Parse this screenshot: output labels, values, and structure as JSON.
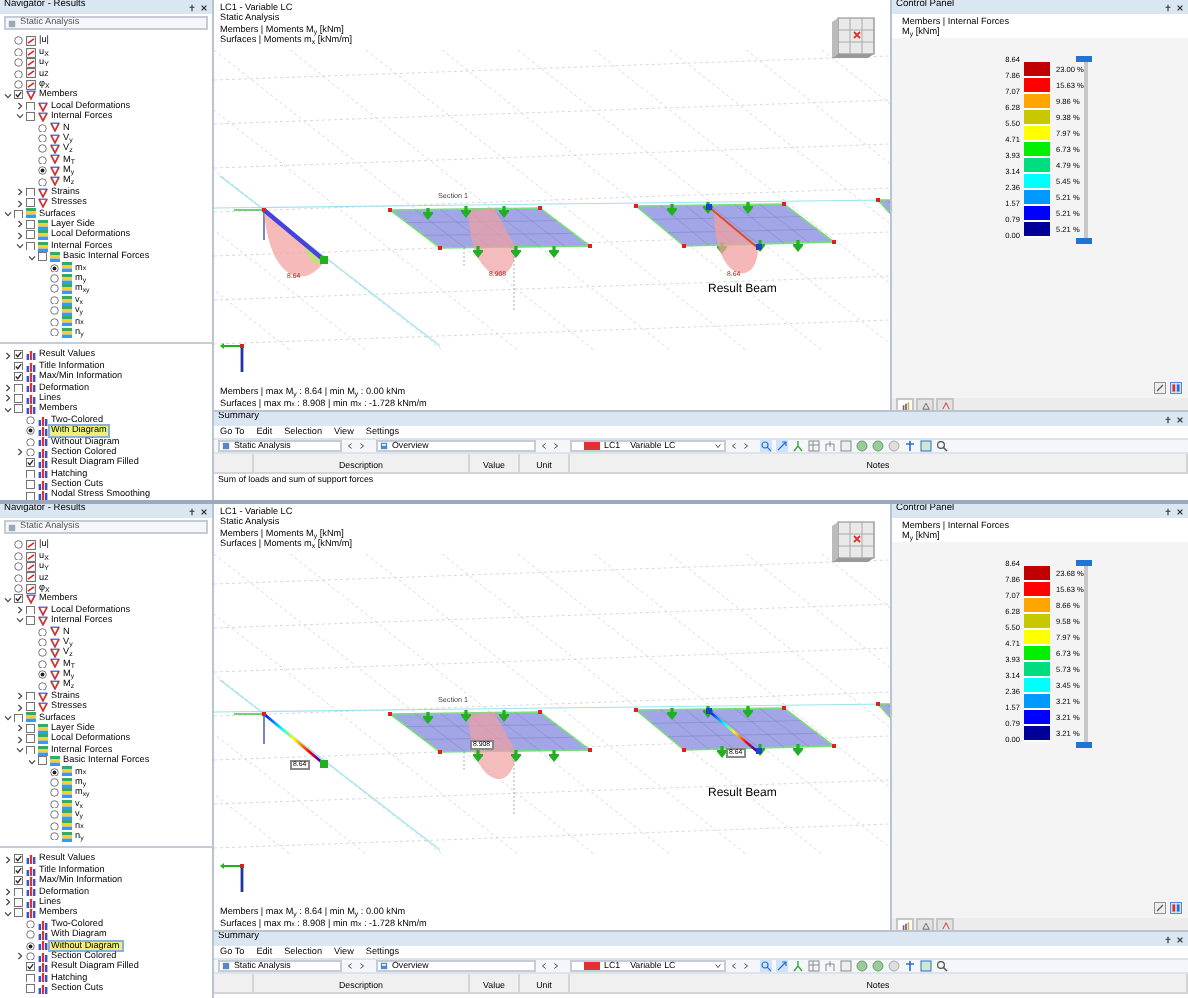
{
  "screens": [
    {
      "navigator": {
        "title": "Navigator - Results",
        "analysis": "Static Analysis",
        "results_tree": [
          {
            "label": "|u|",
            "kind": "radio",
            "checked": false
          },
          {
            "label": "u$_{X}$",
            "kind": "radio",
            "checked": false
          },
          {
            "label": "u$_{Y}$",
            "kind": "radio",
            "checked": false
          },
          {
            "label": "u$_{Z}$",
            "kind": "radio",
            "checked": false
          },
          {
            "label": "φ$_{X}$",
            "kind": "radio",
            "checked": false
          },
          {
            "label": "Members",
            "kind": "check",
            "checked": true,
            "expanded": true,
            "children": [
              {
                "label": "Local Deformations",
                "kind": "check",
                "checked": false,
                "expanded": false
              },
              {
                "label": "Internal Forces",
                "kind": "check",
                "checked": false,
                "expanded": true,
                "children": [
                  {
                    "label": "N",
                    "kind": "radio",
                    "checked": false
                  },
                  {
                    "label": "V$_{y}$",
                    "kind": "radio",
                    "checked": false
                  },
                  {
                    "label": "V$_{z}$",
                    "kind": "radio",
                    "checked": false
                  },
                  {
                    "label": "M$_{T}$",
                    "kind": "radio",
                    "checked": false
                  },
                  {
                    "label": "M$_{y}$",
                    "kind": "radio",
                    "checked": true
                  },
                  {
                    "label": "M$_{z}$",
                    "kind": "radio",
                    "checked": false
                  }
                ]
              },
              {
                "label": "Strains",
                "kind": "check",
                "checked": false,
                "expanded": false
              },
              {
                "label": "Stresses",
                "kind": "check",
                "checked": false,
                "expanded": false
              }
            ]
          },
          {
            "label": "Surfaces",
            "kind": "check",
            "checked": false,
            "expanded": true,
            "children": [
              {
                "label": "Layer Side",
                "kind": "check",
                "checked": false,
                "expanded": false
              },
              {
                "label": "Local Deformations",
                "kind": "check",
                "checked": false,
                "expanded": false
              },
              {
                "label": "Internal Forces",
                "kind": "check",
                "checked": false,
                "expanded": true,
                "children": [
                  {
                    "label": "Basic Internal Forces",
                    "kind": "check",
                    "checked": false,
                    "expanded": true,
                    "children": [
                      {
                        "label": "m$_{x}$",
                        "kind": "radio",
                        "checked": true
                      },
                      {
                        "label": "m$_{y}$",
                        "kind": "radio",
                        "checked": false
                      },
                      {
                        "label": "m$_{xy}$",
                        "kind": "radio",
                        "checked": false
                      },
                      {
                        "label": "v$_{x}$",
                        "kind": "radio",
                        "checked": false
                      },
                      {
                        "label": "v$_{y}$",
                        "kind": "radio",
                        "checked": false
                      },
                      {
                        "label": "n$_{x}$",
                        "kind": "radio",
                        "checked": false
                      },
                      {
                        "label": "n$_{y}$",
                        "kind": "radio",
                        "checked": false
                      }
                    ]
                  }
                ]
              }
            ]
          }
        ],
        "display_tree": [
          {
            "label": "Result Values",
            "kind": "check",
            "checked": true,
            "expanded": false,
            "selected": false
          },
          {
            "label": "Title Information",
            "kind": "check",
            "checked": true,
            "selected": false
          },
          {
            "label": "Max/Min Information",
            "kind": "check",
            "checked": true,
            "selected": false
          },
          {
            "label": "Deformation",
            "kind": "check",
            "checked": false,
            "expanded": false,
            "selected": false
          },
          {
            "label": "Lines",
            "kind": "check",
            "checked": false,
            "expanded": false,
            "selected": false
          },
          {
            "label": "Members",
            "kind": "check",
            "checked": false,
            "expanded": true,
            "selected": false,
            "children": [
              {
                "label": "Two-Colored",
                "kind": "radio",
                "checked": false,
                "selected": false
              },
              {
                "label": "With Diagram",
                "kind": "radio",
                "checked": true,
                "selected": true
              },
              {
                "label": "Without Diagram",
                "kind": "radio",
                "checked": false,
                "selected": false
              },
              {
                "label": "Section Colored",
                "kind": "radio",
                "checked": false,
                "expanded": false,
                "selected": false
              },
              {
                "label": "Result Diagram Filled",
                "kind": "check",
                "checked": true,
                "selected": false
              },
              {
                "label": "Hatching",
                "kind": "check",
                "checked": false,
                "selected": false
              },
              {
                "label": "Section Cuts",
                "kind": "check",
                "checked": false,
                "selected": false
              },
              {
                "label": "Nodal Stress Smoothing",
                "kind": "check",
                "checked": false,
                "selected": false
              }
            ]
          }
        ]
      },
      "viewport": {
        "info_lines": [
          "LC1 - Variable LC",
          "Static Analysis",
          "Members | Moments M$_{y}$ [kNm]",
          "Surfaces | Moments m$_{x}$ [kNm/m]"
        ],
        "section_label": "Section 1",
        "result_label": "Result Beam",
        "diagram_labels": [
          "8.64",
          "8.908",
          "8.64"
        ],
        "footer_lines": [
          "Members | max M$_{y}$ : 8.64 | min M$_{y}$ : 0.00 kNm",
          "Surfaces | max m$_{x}$ : 8.908 | min m$_{x}$ : -1.728 kNm/m"
        ]
      },
      "control_panel": {
        "title": "Control Panel",
        "subtitle_lines": [
          "Members | Internal Forces",
          "M$_{y}$ [kNm]"
        ],
        "legend": [
          {
            "value": "8.64",
            "color": "#c00000",
            "share": "23.00 %"
          },
          {
            "value": "7.86",
            "color": "#ff0000",
            "share": "15.63 %"
          },
          {
            "value": "7.07",
            "color": "#ffa500",
            "share": "9.86 %"
          },
          {
            "value": "6.28",
            "color": "#c8c800",
            "share": "9.38 %"
          },
          {
            "value": "5.50",
            "color": "#ffff00",
            "share": "7.97 %"
          },
          {
            "value": "4.71",
            "color": "#00ee00",
            "share": "6.73 %"
          },
          {
            "value": "3.93",
            "color": "#00dd80",
            "share": "4.79 %"
          },
          {
            "value": "3.14",
            "color": "#00ffff",
            "share": "5.45 %"
          },
          {
            "value": "2.36",
            "color": "#0099ff",
            "share": "5.21 %"
          },
          {
            "value": "1.57",
            "color": "#0000ff",
            "share": "5.21 %"
          },
          {
            "value": "0.79",
            "color": "#000099",
            "share": "5.21 %"
          }
        ],
        "min_value": "0.00",
        "tabs": [
          {
            "selected": true
          },
          {
            "selected": false
          },
          {
            "selected": false
          }
        ]
      },
      "summary": {
        "title": "Summary",
        "menu": [
          "Go To",
          "Edit",
          "Selection",
          "View",
          "Settings"
        ],
        "analysis": "Static Analysis",
        "view": "Overview",
        "load_case": "LC1",
        "load_case_name": "Variable LC",
        "columns": [
          "Description",
          "Value",
          "Unit",
          "Notes"
        ],
        "rows": [
          "Sum of loads and sum of support forces"
        ]
      }
    },
    {
      "navigator": {
        "title": "Navigator - Results",
        "analysis": "Static Analysis",
        "results_tree": [
          {
            "label": "|u|",
            "kind": "radio",
            "checked": false
          },
          {
            "label": "u$_{X}$",
            "kind": "radio",
            "checked": false
          },
          {
            "label": "u$_{Y}$",
            "kind": "radio",
            "checked": false
          },
          {
            "label": "u$_{Z}$",
            "kind": "radio",
            "checked": false
          },
          {
            "label": "φ$_{X}$",
            "kind": "radio",
            "checked": false
          },
          {
            "label": "Members",
            "kind": "check",
            "checked": true,
            "expanded": true,
            "children": [
              {
                "label": "Local Deformations",
                "kind": "check",
                "checked": false,
                "expanded": false
              },
              {
                "label": "Internal Forces",
                "kind": "check",
                "checked": false,
                "expanded": true,
                "children": [
                  {
                    "label": "N",
                    "kind": "radio",
                    "checked": false
                  },
                  {
                    "label": "V$_{y}$",
                    "kind": "radio",
                    "checked": false
                  },
                  {
                    "label": "V$_{z}$",
                    "kind": "radio",
                    "checked": false
                  },
                  {
                    "label": "M$_{T}$",
                    "kind": "radio",
                    "checked": false
                  },
                  {
                    "label": "M$_{y}$",
                    "kind": "radio",
                    "checked": true
                  },
                  {
                    "label": "M$_{z}$",
                    "kind": "radio",
                    "checked": false
                  }
                ]
              },
              {
                "label": "Strains",
                "kind": "check",
                "checked": false,
                "expanded": false
              },
              {
                "label": "Stresses",
                "kind": "check",
                "checked": false,
                "expanded": false
              }
            ]
          },
          {
            "label": "Surfaces",
            "kind": "check",
            "checked": false,
            "expanded": true,
            "children": [
              {
                "label": "Layer Side",
                "kind": "check",
                "checked": false,
                "expanded": false
              },
              {
                "label": "Local Deformations",
                "kind": "check",
                "checked": false,
                "expanded": false
              },
              {
                "label": "Internal Forces",
                "kind": "check",
                "checked": false,
                "expanded": true,
                "children": [
                  {
                    "label": "Basic Internal Forces",
                    "kind": "check",
                    "checked": false,
                    "expanded": true,
                    "children": [
                      {
                        "label": "m$_{x}$",
                        "kind": "radio",
                        "checked": true
                      },
                      {
                        "label": "m$_{y}$",
                        "kind": "radio",
                        "checked": false
                      },
                      {
                        "label": "m$_{xy}$",
                        "kind": "radio",
                        "checked": false
                      },
                      {
                        "label": "v$_{x}$",
                        "kind": "radio",
                        "checked": false
                      },
                      {
                        "label": "v$_{y}$",
                        "kind": "radio",
                        "checked": false
                      },
                      {
                        "label": "n$_{x}$",
                        "kind": "radio",
                        "checked": false
                      },
                      {
                        "label": "n$_{y}$",
                        "kind": "radio",
                        "checked": false
                      }
                    ]
                  }
                ]
              }
            ]
          }
        ],
        "display_tree": [
          {
            "label": "Result Values",
            "kind": "check",
            "checked": true,
            "expanded": false,
            "selected": false
          },
          {
            "label": "Title Information",
            "kind": "check",
            "checked": true,
            "selected": false
          },
          {
            "label": "Max/Min Information",
            "kind": "check",
            "checked": true,
            "selected": false
          },
          {
            "label": "Deformation",
            "kind": "check",
            "checked": false,
            "expanded": false,
            "selected": false
          },
          {
            "label": "Lines",
            "kind": "check",
            "checked": false,
            "expanded": false,
            "selected": false
          },
          {
            "label": "Members",
            "kind": "check",
            "checked": false,
            "expanded": true,
            "selected": false,
            "children": [
              {
                "label": "Two-Colored",
                "kind": "radio",
                "checked": false,
                "selected": false
              },
              {
                "label": "With Diagram",
                "kind": "radio",
                "checked": false,
                "selected": false
              },
              {
                "label": "Without Diagram",
                "kind": "radio",
                "checked": true,
                "selected": true
              },
              {
                "label": "Section Colored",
                "kind": "radio",
                "checked": false,
                "expanded": false,
                "selected": false
              },
              {
                "label": "Result Diagram Filled",
                "kind": "check",
                "checked": true,
                "selected": false
              },
              {
                "label": "Hatching",
                "kind": "check",
                "checked": false,
                "selected": false
              },
              {
                "label": "Section Cuts",
                "kind": "check",
                "checked": false,
                "selected": false
              }
            ]
          }
        ]
      },
      "viewport": {
        "info_lines": [
          "LC1 - Variable LC",
          "Static Analysis",
          "Members | Moments M$_{y}$ [kNm]",
          "Surfaces | Moments m$_{x}$ [kNm/m]"
        ],
        "section_label": "Section 1",
        "result_label": "Result Beam",
        "diagram_labels": [
          "8.64",
          "8.908",
          "8.64"
        ],
        "footer_lines": [
          "Members | max M$_{y}$ : 8.64 | min M$_{y}$ : 0.00 kNm",
          "Surfaces | max m$_{x}$ : 8.908 | min m$_{x}$ : -1.728 kNm/m"
        ]
      },
      "control_panel": {
        "title": "Control Panel",
        "subtitle_lines": [
          "Members | Internal Forces",
          "M$_{y}$ [kNm]"
        ],
        "legend": [
          {
            "value": "8.64",
            "color": "#c00000",
            "share": "23.68 %"
          },
          {
            "value": "7.86",
            "color": "#ff0000",
            "share": "15.63 %"
          },
          {
            "value": "7.07",
            "color": "#ffa500",
            "share": "8.66 %"
          },
          {
            "value": "6.28",
            "color": "#c8c800",
            "share": "9.58 %"
          },
          {
            "value": "5.50",
            "color": "#ffff00",
            "share": "7.97 %"
          },
          {
            "value": "4.71",
            "color": "#00ee00",
            "share": "6.73 %"
          },
          {
            "value": "3.93",
            "color": "#00dd80",
            "share": "5.73 %"
          },
          {
            "value": "3.14",
            "color": "#00ffff",
            "share": "3.45 %"
          },
          {
            "value": "2.36",
            "color": "#0099ff",
            "share": "3.21 %"
          },
          {
            "value": "1.57",
            "color": "#0000ff",
            "share": "3.21 %"
          },
          {
            "value": "0.79",
            "color": "#000099",
            "share": "3.21 %"
          }
        ],
        "min_value": "0.00",
        "tabs": [
          {
            "selected": true
          },
          {
            "selected": false
          },
          {
            "selected": false
          }
        ]
      },
      "summary": {
        "title": "Summary",
        "menu": [
          "Go To",
          "Edit",
          "Selection",
          "View",
          "Settings"
        ],
        "analysis": "Static Analysis",
        "view": "Overview",
        "load_case": "LC1",
        "load_case_name": "Variable LC",
        "columns": [
          "Description",
          "Value",
          "Unit",
          "Notes"
        ]
      }
    }
  ]
}
